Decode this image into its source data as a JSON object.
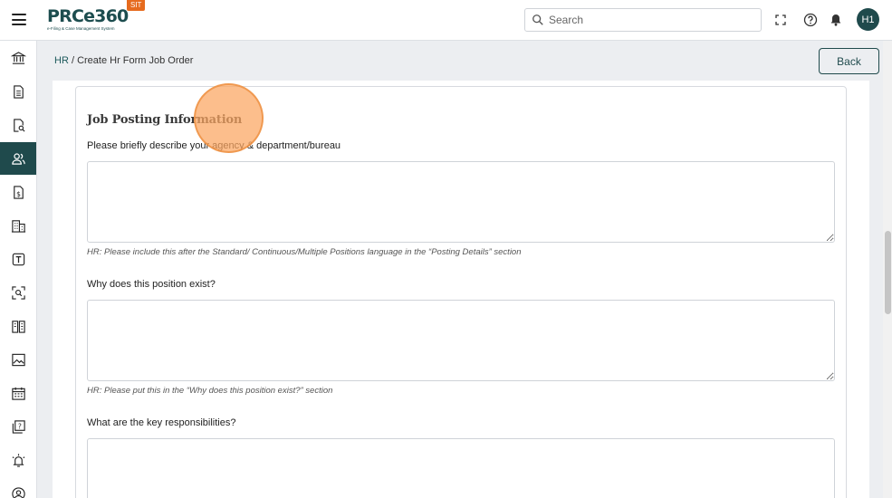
{
  "app": {
    "logo_text": "PRCe360",
    "logo_tagline": "e-Filing & Case Management System",
    "env_badge": "SIT"
  },
  "header": {
    "search_placeholder": "Search",
    "avatar_initials": "H1",
    "icons": [
      "menu-icon",
      "fullscreen-icon",
      "help-icon",
      "bell-icon"
    ]
  },
  "sidebar": {
    "items": [
      {
        "icon": "bank-icon",
        "active": false
      },
      {
        "icon": "document-icon",
        "active": false
      },
      {
        "icon": "document-search-icon",
        "active": false
      },
      {
        "icon": "users-icon",
        "active": true
      },
      {
        "icon": "invoice-dollar-icon",
        "active": false
      },
      {
        "icon": "building-icon",
        "active": false
      },
      {
        "icon": "text-box-icon",
        "active": false
      },
      {
        "icon": "scan-search-icon",
        "active": false
      },
      {
        "icon": "book-icon",
        "active": false
      },
      {
        "icon": "image-icon",
        "active": false
      },
      {
        "icon": "calendar-icon",
        "active": false
      },
      {
        "icon": "question-copy-icon",
        "active": false
      },
      {
        "icon": "alarm-icon",
        "active": false
      },
      {
        "icon": "user-circle-icon",
        "active": false
      }
    ]
  },
  "breadcrumb": {
    "root": "HR",
    "separator": " / ",
    "current": "Create Hr Form Job Order"
  },
  "actions": {
    "back_label": "Back"
  },
  "form": {
    "section_title": "Job Posting Information",
    "questions": [
      {
        "label": "Please briefly describe your agency & department/bureau",
        "value": "",
        "hint": "HR: Please include this after the Standard/ Continuous/Multiple Positions language in the “Posting Details” section"
      },
      {
        "label": "Why does this position exist?",
        "value": "",
        "hint": "HR: Please put this in the “Why does this position exist?” section"
      },
      {
        "label": "What are the key responsibilities?",
        "value": "",
        "hint": ""
      }
    ]
  },
  "colors": {
    "brand_dark": "#1f4a4c",
    "badge_orange": "#e66b1e",
    "click_marker": "#fba55f"
  }
}
